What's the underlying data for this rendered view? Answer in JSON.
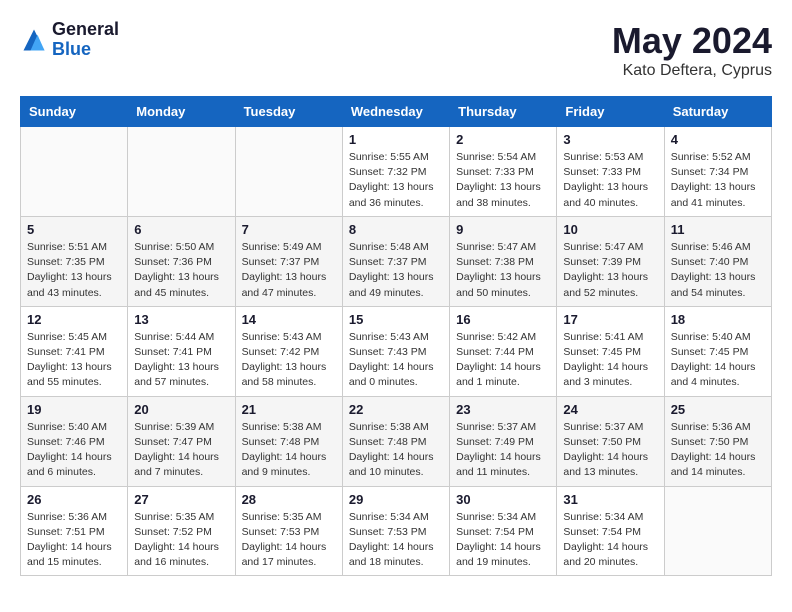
{
  "logo": {
    "general": "General",
    "blue": "Blue"
  },
  "title": "May 2024",
  "subtitle": "Kato Deftera, Cyprus",
  "weekdays": [
    "Sunday",
    "Monday",
    "Tuesday",
    "Wednesday",
    "Thursday",
    "Friday",
    "Saturday"
  ],
  "weeks": [
    [
      {
        "day": "",
        "info": ""
      },
      {
        "day": "",
        "info": ""
      },
      {
        "day": "",
        "info": ""
      },
      {
        "day": "1",
        "info": "Sunrise: 5:55 AM\nSunset: 7:32 PM\nDaylight: 13 hours\nand 36 minutes."
      },
      {
        "day": "2",
        "info": "Sunrise: 5:54 AM\nSunset: 7:33 PM\nDaylight: 13 hours\nand 38 minutes."
      },
      {
        "day": "3",
        "info": "Sunrise: 5:53 AM\nSunset: 7:33 PM\nDaylight: 13 hours\nand 40 minutes."
      },
      {
        "day": "4",
        "info": "Sunrise: 5:52 AM\nSunset: 7:34 PM\nDaylight: 13 hours\nand 41 minutes."
      }
    ],
    [
      {
        "day": "5",
        "info": "Sunrise: 5:51 AM\nSunset: 7:35 PM\nDaylight: 13 hours\nand 43 minutes."
      },
      {
        "day": "6",
        "info": "Sunrise: 5:50 AM\nSunset: 7:36 PM\nDaylight: 13 hours\nand 45 minutes."
      },
      {
        "day": "7",
        "info": "Sunrise: 5:49 AM\nSunset: 7:37 PM\nDaylight: 13 hours\nand 47 minutes."
      },
      {
        "day": "8",
        "info": "Sunrise: 5:48 AM\nSunset: 7:37 PM\nDaylight: 13 hours\nand 49 minutes."
      },
      {
        "day": "9",
        "info": "Sunrise: 5:47 AM\nSunset: 7:38 PM\nDaylight: 13 hours\nand 50 minutes."
      },
      {
        "day": "10",
        "info": "Sunrise: 5:47 AM\nSunset: 7:39 PM\nDaylight: 13 hours\nand 52 minutes."
      },
      {
        "day": "11",
        "info": "Sunrise: 5:46 AM\nSunset: 7:40 PM\nDaylight: 13 hours\nand 54 minutes."
      }
    ],
    [
      {
        "day": "12",
        "info": "Sunrise: 5:45 AM\nSunset: 7:41 PM\nDaylight: 13 hours\nand 55 minutes."
      },
      {
        "day": "13",
        "info": "Sunrise: 5:44 AM\nSunset: 7:41 PM\nDaylight: 13 hours\nand 57 minutes."
      },
      {
        "day": "14",
        "info": "Sunrise: 5:43 AM\nSunset: 7:42 PM\nDaylight: 13 hours\nand 58 minutes."
      },
      {
        "day": "15",
        "info": "Sunrise: 5:43 AM\nSunset: 7:43 PM\nDaylight: 14 hours\nand 0 minutes."
      },
      {
        "day": "16",
        "info": "Sunrise: 5:42 AM\nSunset: 7:44 PM\nDaylight: 14 hours\nand 1 minute."
      },
      {
        "day": "17",
        "info": "Sunrise: 5:41 AM\nSunset: 7:45 PM\nDaylight: 14 hours\nand 3 minutes."
      },
      {
        "day": "18",
        "info": "Sunrise: 5:40 AM\nSunset: 7:45 PM\nDaylight: 14 hours\nand 4 minutes."
      }
    ],
    [
      {
        "day": "19",
        "info": "Sunrise: 5:40 AM\nSunset: 7:46 PM\nDaylight: 14 hours\nand 6 minutes."
      },
      {
        "day": "20",
        "info": "Sunrise: 5:39 AM\nSunset: 7:47 PM\nDaylight: 14 hours\nand 7 minutes."
      },
      {
        "day": "21",
        "info": "Sunrise: 5:38 AM\nSunset: 7:48 PM\nDaylight: 14 hours\nand 9 minutes."
      },
      {
        "day": "22",
        "info": "Sunrise: 5:38 AM\nSunset: 7:48 PM\nDaylight: 14 hours\nand 10 minutes."
      },
      {
        "day": "23",
        "info": "Sunrise: 5:37 AM\nSunset: 7:49 PM\nDaylight: 14 hours\nand 11 minutes."
      },
      {
        "day": "24",
        "info": "Sunrise: 5:37 AM\nSunset: 7:50 PM\nDaylight: 14 hours\nand 13 minutes."
      },
      {
        "day": "25",
        "info": "Sunrise: 5:36 AM\nSunset: 7:50 PM\nDaylight: 14 hours\nand 14 minutes."
      }
    ],
    [
      {
        "day": "26",
        "info": "Sunrise: 5:36 AM\nSunset: 7:51 PM\nDaylight: 14 hours\nand 15 minutes."
      },
      {
        "day": "27",
        "info": "Sunrise: 5:35 AM\nSunset: 7:52 PM\nDaylight: 14 hours\nand 16 minutes."
      },
      {
        "day": "28",
        "info": "Sunrise: 5:35 AM\nSunset: 7:53 PM\nDaylight: 14 hours\nand 17 minutes."
      },
      {
        "day": "29",
        "info": "Sunrise: 5:34 AM\nSunset: 7:53 PM\nDaylight: 14 hours\nand 18 minutes."
      },
      {
        "day": "30",
        "info": "Sunrise: 5:34 AM\nSunset: 7:54 PM\nDaylight: 14 hours\nand 19 minutes."
      },
      {
        "day": "31",
        "info": "Sunrise: 5:34 AM\nSunset: 7:54 PM\nDaylight: 14 hours\nand 20 minutes."
      },
      {
        "day": "",
        "info": ""
      }
    ]
  ]
}
